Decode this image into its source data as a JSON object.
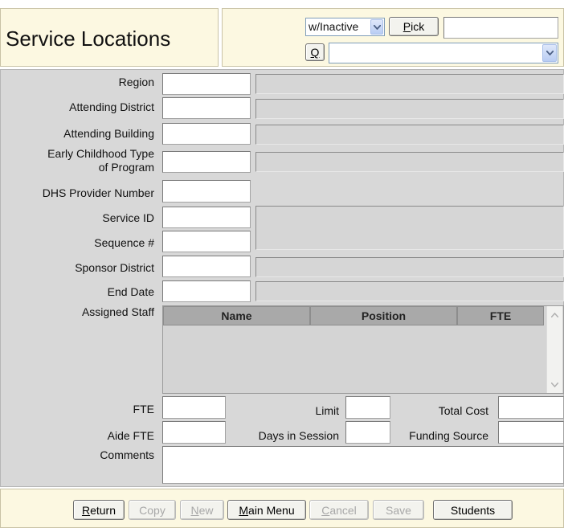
{
  "header": {
    "title": "Service Locations",
    "filter_select": "w/Inactive",
    "pick_label": "Pick",
    "pick_accesskey": "P",
    "pick_rest": "ick",
    "q_label": "Q",
    "pick_value": "",
    "record_select_value": ""
  },
  "form": {
    "region": {
      "label": "Region",
      "code": "",
      "desc": ""
    },
    "attending_district": {
      "label": "Attending District",
      "code": "",
      "desc": ""
    },
    "attending_building": {
      "label": "Attending Building",
      "code": "",
      "desc": ""
    },
    "early_childhood": {
      "label_line1": "Early Childhood Type",
      "label_line2": "of Program",
      "code": "",
      "desc": ""
    },
    "dhs_provider": {
      "label": "DHS Provider Number",
      "value": ""
    },
    "service_id": {
      "label": "Service ID",
      "value": ""
    },
    "sequence": {
      "label": "Sequence #",
      "value": ""
    },
    "service_desc": "",
    "sponsor_district": {
      "label": "Sponsor District",
      "code": "",
      "desc": ""
    },
    "end_date": {
      "label": "End Date",
      "value": "",
      "desc": ""
    },
    "assigned_staff": {
      "label": "Assigned Staff",
      "columns": [
        "Name",
        "Position",
        "FTE"
      ],
      "rows": []
    },
    "fte": {
      "label": "FTE",
      "value": ""
    },
    "limit": {
      "label": "Limit",
      "value": ""
    },
    "total_cost": {
      "label": "Total Cost",
      "value": ""
    },
    "aide_fte": {
      "label": "Aide FTE",
      "value": ""
    },
    "days_in_session": {
      "label": "Days in Session",
      "value": ""
    },
    "funding_source": {
      "label": "Funding Source",
      "value": ""
    },
    "comments": {
      "label": "Comments",
      "value": ""
    }
  },
  "footer": {
    "buttons": [
      {
        "id": "return",
        "first": "R",
        "rest": "eturn",
        "enabled": true
      },
      {
        "id": "copy",
        "first": "Copy",
        "rest": "",
        "enabled": false
      },
      {
        "id": "new",
        "first": "N",
        "rest": "ew",
        "enabled": false
      },
      {
        "id": "main_menu",
        "first": "M",
        "rest": "ain Menu",
        "enabled": true
      },
      {
        "id": "cancel",
        "first": "C",
        "rest": "ancel",
        "enabled": false
      },
      {
        "id": "save",
        "first": "Save",
        "rest": "",
        "enabled": false
      },
      {
        "id": "students",
        "first": "Stu",
        "rest": "dents",
        "enabled": true
      }
    ]
  },
  "colors": {
    "panel_bg": "#d8d8d8",
    "header_bg": "#fcf8e1",
    "grid_header": "#a9a9a9"
  }
}
